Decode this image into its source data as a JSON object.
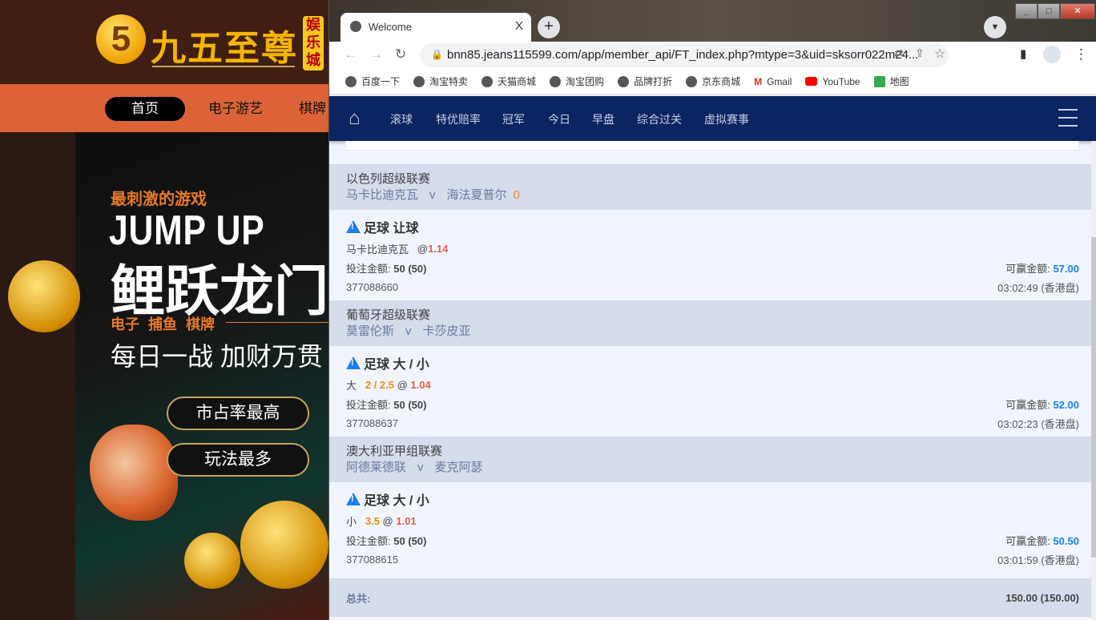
{
  "background_site": {
    "logo_text": "九五至尊",
    "logo_badge": "娱乐城",
    "logo_mark": "5",
    "nav": [
      "首页",
      "电子游艺",
      "棋牌"
    ],
    "banner": {
      "tagline": "最刺激的游戏",
      "title_en": "JUMP UP",
      "title_cn": "鲤跃龙门",
      "categories": "电子 捕鱼 棋牌",
      "slogan": "每日一战 加财万贯",
      "btn1": "市占率最高",
      "btn2": "玩法最多"
    }
  },
  "browser": {
    "tab_title": "Welcome",
    "tab_close": "X",
    "new_tab": "+",
    "url": "bnn85.jeans115599.com/app/member_api/FT_index.php?mtype=3&uid=sksorr022m24...",
    "bookmarks": [
      "百度一下",
      "淘宝特卖",
      "天猫商城",
      "淘宝团购",
      "品牌打折",
      "京东商城",
      "Gmail",
      "YouTube",
      "地图"
    ]
  },
  "nav": {
    "items": [
      "滚球",
      "特优赔率",
      "冠军",
      "今日",
      "早盘",
      "综合过关",
      "虚拟赛事"
    ]
  },
  "bets": [
    {
      "league": "以色列超级联赛",
      "home": "马卡比迪克瓦",
      "vs": "v",
      "away": "海法夏普尔",
      "score": "0",
      "type": "足球 让球",
      "pick": "马卡比迪克瓦",
      "line": "",
      "odds": "1.14",
      "stake_label": "投注金额:",
      "stake": "50 (50)",
      "win_label": "可赢金额:",
      "win": "57.00",
      "id": "377088660",
      "time": "03:02:49 (香港盘)"
    },
    {
      "league": "葡萄牙超级联赛",
      "home": "莫雷伦斯",
      "vs": "v",
      "away": "卡莎皮亚",
      "score": "",
      "type": "足球 大 / 小",
      "pick": "大",
      "line": "2 / 2.5",
      "odds": "1.04",
      "stake_label": "投注金额:",
      "stake": "50 (50)",
      "win_label": "可赢金额:",
      "win": "52.00",
      "id": "377088637",
      "time": "03:02:23 (香港盘)"
    },
    {
      "league": "澳大利亚甲组联赛",
      "home": "阿德莱德联",
      "vs": "v",
      "away": "麦克阿瑟",
      "score": "",
      "type": "足球 大 / 小",
      "pick": "小",
      "line": "3.5",
      "odds": "1.01",
      "stake_label": "投注金额:",
      "stake": "50 (50)",
      "win_label": "可赢金额:",
      "win": "50.50",
      "id": "377088615",
      "time": "03:01:59 (香港盘)"
    }
  ],
  "total": {
    "label": "总共:",
    "value": "150.00 (150.00)"
  },
  "colors": {
    "nav": "#0c2461",
    "league_bg": "#d5dcea",
    "odds": "#e55a4a",
    "line": "#f08a10",
    "win": "#1a7ff0"
  }
}
